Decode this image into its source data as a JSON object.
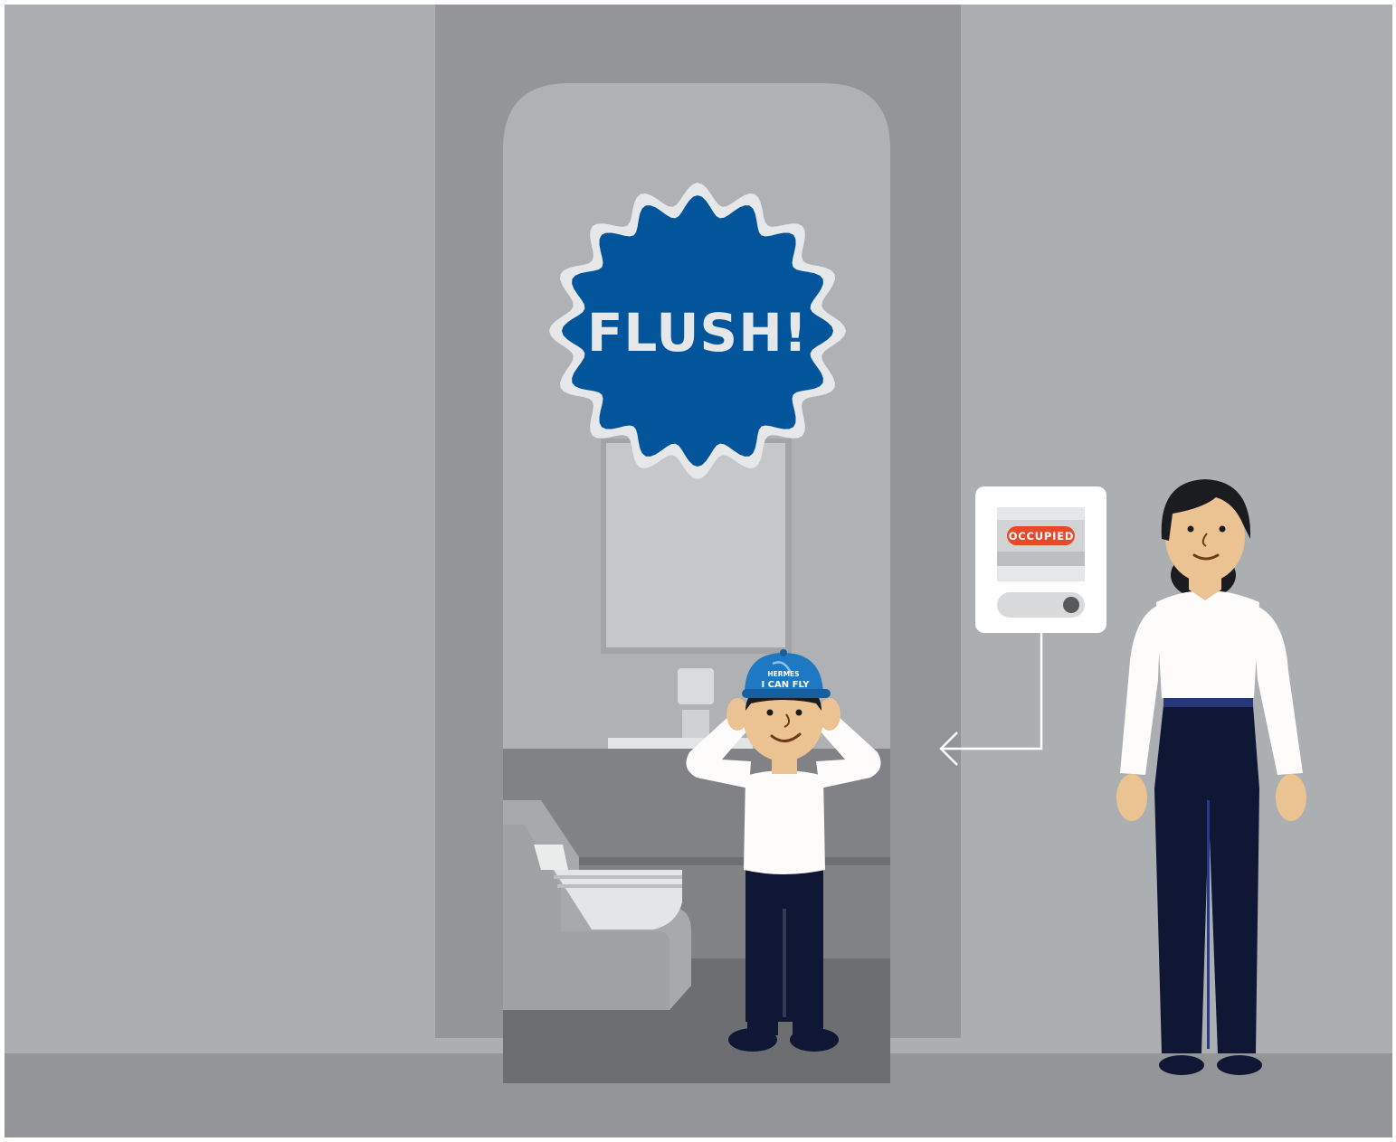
{
  "scene": {
    "burst_text": "FLUSH!",
    "sign_status": "OCCUPIED",
    "cap_brand": "HERMES",
    "cap_slogan": "I CAN FLY"
  },
  "colors": {
    "wall": "#abafb1",
    "floor": "#949599",
    "door_frame": "#949599",
    "cabin": "#b0b1b4",
    "burst_fill": "#02559a",
    "burst_ring": "#e6e7e8",
    "burst_text": "#e6e7e8",
    "occupied_badge": "#e8492b",
    "navy": "#0f1734",
    "shirt": "#fdfcfb",
    "skin": "#ebc392",
    "cap": "#1e78c2"
  }
}
